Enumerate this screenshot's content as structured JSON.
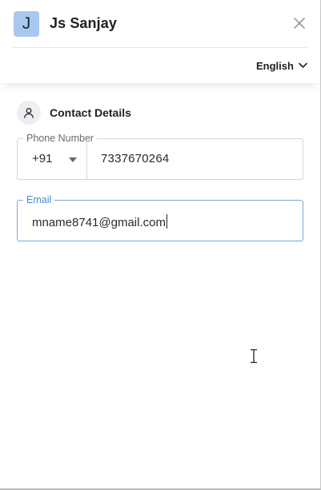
{
  "header": {
    "avatar_initial": "J",
    "user_name": "Js Sanjay",
    "language": "English"
  },
  "contact": {
    "section_title": "Contact Details",
    "phone": {
      "label": "Phone Number",
      "country_code": "+91",
      "number": "7337670264"
    },
    "email": {
      "label": "Email",
      "value": "mname8741@gmail.com"
    }
  },
  "colors": {
    "avatar_bg": "#a8c8f0",
    "focus_border": "#7aa7d6",
    "focus_label": "#4a8ad0"
  },
  "icons": [
    "close-icon",
    "chevron-down-icon",
    "user-icon",
    "caret-down-icon",
    "text-cursor-icon"
  ]
}
